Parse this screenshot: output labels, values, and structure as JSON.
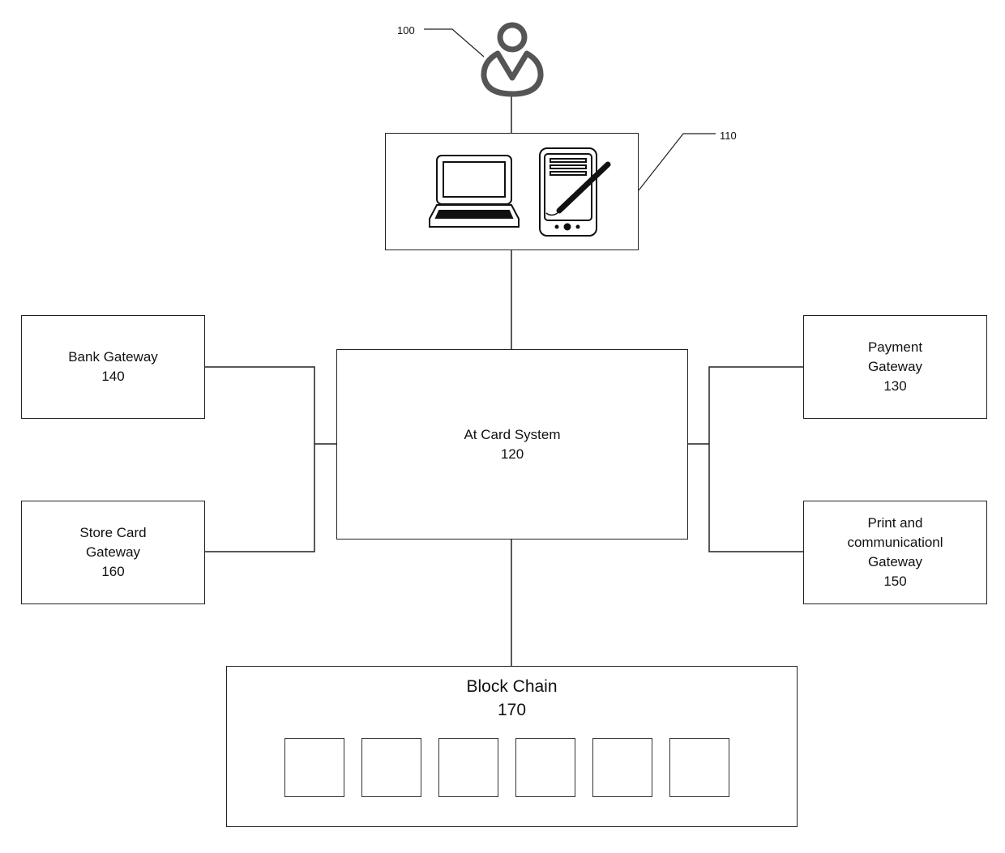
{
  "diagram": {
    "user": {
      "ref": "100",
      "icon": "user-icon"
    },
    "devices": {
      "ref": "110",
      "icons": [
        "laptop-icon",
        "tablet-with-stylus-icon"
      ]
    },
    "nodes": [
      {
        "id": "card_system",
        "lines": [
          "At Card System",
          "120"
        ]
      },
      {
        "id": "payment_gateway",
        "lines": [
          "Payment",
          "Gateway",
          "130"
        ]
      },
      {
        "id": "bank_gateway",
        "lines": [
          "Bank Gateway",
          "140"
        ]
      },
      {
        "id": "print_gateway",
        "lines": [
          "Print and",
          "communicationl",
          "Gateway",
          "150"
        ]
      },
      {
        "id": "store_card_gateway",
        "lines": [
          "Store Card",
          "Gateway",
          "160"
        ]
      }
    ],
    "blockchain": {
      "title": "Block Chain",
      "ref": "170",
      "block_count": 6
    },
    "edges": [
      [
        "user",
        "devices"
      ],
      [
        "devices",
        "card_system"
      ],
      [
        "card_system",
        "bank_gateway"
      ],
      [
        "card_system",
        "store_card_gateway"
      ],
      [
        "card_system",
        "payment_gateway"
      ],
      [
        "card_system",
        "print_gateway"
      ],
      [
        "card_system",
        "blockchain"
      ]
    ]
  }
}
